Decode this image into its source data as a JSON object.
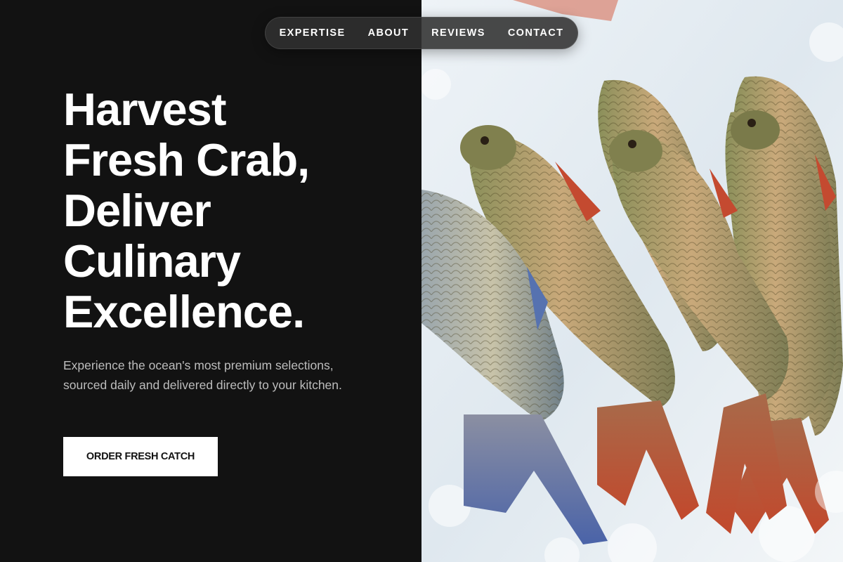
{
  "nav": {
    "links": [
      {
        "label": "EXPERTISE"
      },
      {
        "label": "ABOUT"
      },
      {
        "label": "REVIEWS"
      },
      {
        "label": "CONTACT"
      }
    ]
  },
  "hero": {
    "title_lines": [
      "Harvest",
      "Fresh Crab,",
      "Deliver",
      "Culinary",
      "Excellence."
    ],
    "description": "Experience the ocean's most premium selections, sourced daily and delivered directly to your kitchen.",
    "cta_label": "ORDER FRESH CATCH"
  },
  "colors": {
    "background": "#121212",
    "text_primary": "#ffffff",
    "text_secondary": "#bdbdbd",
    "button_bg": "#ffffff",
    "button_text": "#121212",
    "nav_bg": "#303030"
  },
  "image": {
    "subject": "fresh-fish-on-ice-photo"
  }
}
